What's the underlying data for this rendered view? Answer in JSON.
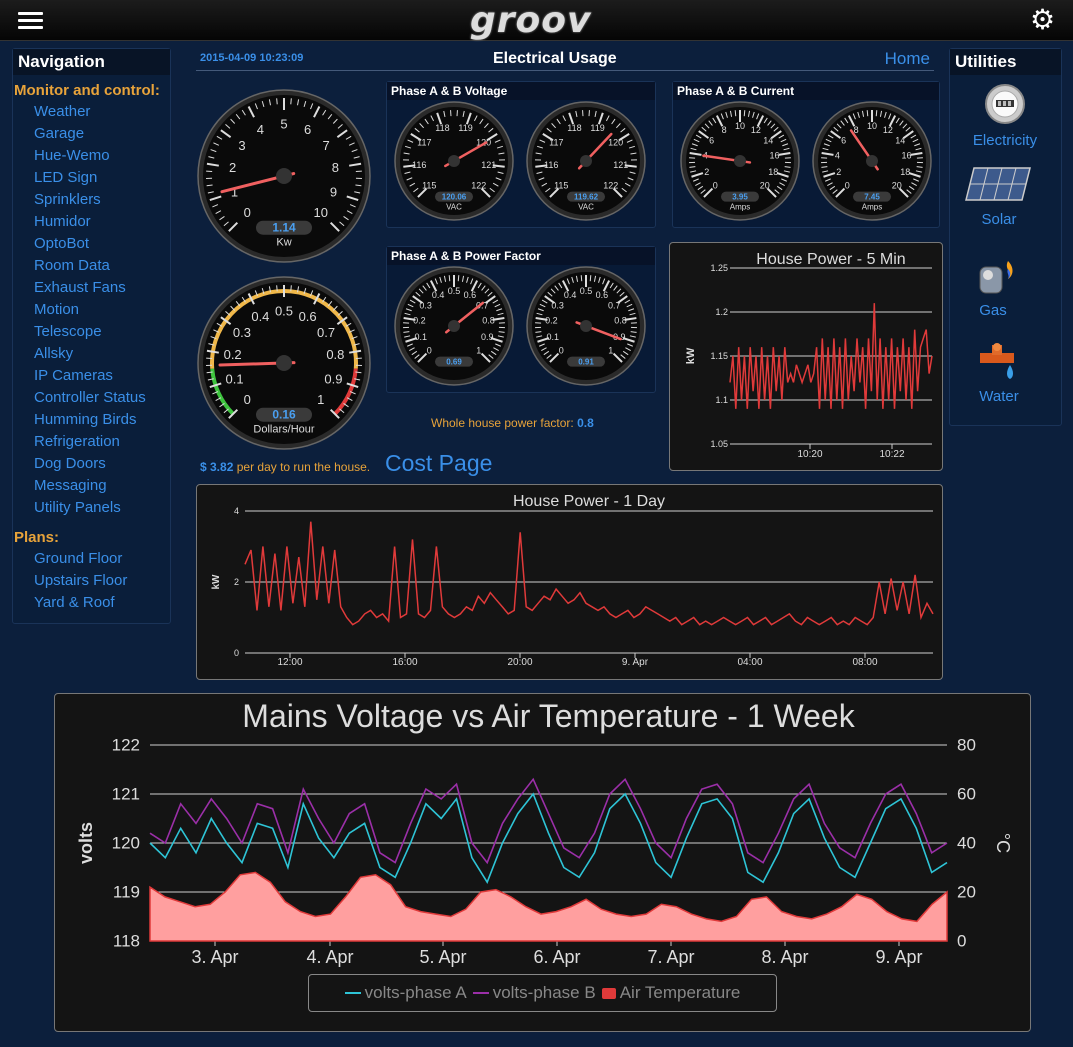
{
  "topbar": {
    "logo": "groov",
    "menu_icon": "hamburger-icon",
    "settings_icon": "gear-icon"
  },
  "navigation": {
    "title": "Navigation",
    "sections": [
      {
        "label": "Monitor and control:",
        "items": [
          "Weather",
          "Garage",
          "Hue-Wemo",
          "LED Sign",
          "Sprinklers",
          "Humidor",
          "OptoBot",
          "Room Data",
          "Exhaust Fans",
          "Motion",
          "Telescope",
          "Allsky",
          "IP Cameras",
          "Controller Status",
          "Humming Birds",
          "Refrigeration",
          "Dog Doors",
          "Messaging",
          "Utility Panels"
        ]
      },
      {
        "label": "Plans:",
        "items": [
          "Ground Floor",
          "Upstairs Floor",
          "Yard & Roof"
        ]
      }
    ]
  },
  "header": {
    "timestamp": "2015-04-09 10:23:09",
    "title": "Electrical Usage",
    "home": "Home"
  },
  "gauges": {
    "kw": {
      "value": 1.14,
      "display": "1.14",
      "unit": "Kw",
      "min": 0,
      "max": 10,
      "ticks": [
        "0",
        "1",
        "2",
        "3",
        "4",
        "5",
        "6",
        "7",
        "8",
        "9",
        "10"
      ]
    },
    "dollars": {
      "value": 0.16,
      "display": "0.16",
      "unit": "Dollars/Hour",
      "min": 0,
      "max": 1,
      "ticks": [
        "0",
        "0.1",
        "0.2",
        "0.3",
        "0.4",
        "0.5",
        "0.6",
        "0.7",
        "0.8",
        "0.9",
        "1"
      ]
    },
    "voltage": {
      "title": "Phase A & B Voltage",
      "ticks": [
        "115",
        "116",
        "117",
        "118",
        "119",
        "120",
        "121",
        "122"
      ],
      "min": 115,
      "max": 122,
      "unit": "VAC",
      "a": {
        "value": 120.06,
        "display": "120.06"
      },
      "b": {
        "value": 119.62,
        "display": "119.62"
      }
    },
    "current": {
      "title": "Phase A & B Current",
      "ticks": [
        "0",
        "2",
        "4",
        "6",
        "8",
        "10",
        "12",
        "14",
        "16",
        "18",
        "20"
      ],
      "min": 0,
      "max": 20,
      "unit": "Amps",
      "a": {
        "value": 3.95,
        "display": "3.95"
      },
      "b": {
        "value": 7.45,
        "display": "7.45"
      }
    },
    "power_factor": {
      "title": "Phase A & B Power Factor",
      "ticks": [
        "0",
        "0.1",
        "0.2",
        "0.3",
        "0.4",
        "0.5",
        "0.6",
        "0.7",
        "0.8",
        "0.9",
        "1"
      ],
      "min": 0,
      "max": 1,
      "a": {
        "value": 0.69,
        "display": "0.69"
      },
      "b": {
        "value": 0.91,
        "display": "0.91"
      }
    }
  },
  "whole_pf": {
    "label": "Whole house power factor:",
    "value": "0.8"
  },
  "cost": {
    "amount": "$ 3.82",
    "text": "per day to run the house.",
    "link": "Cost Page"
  },
  "utilities": {
    "title": "Utilities",
    "items": [
      {
        "label": "Electricity",
        "icon": "electric-meter-icon"
      },
      {
        "label": "Solar",
        "icon": "solar-panel-icon"
      },
      {
        "label": "Gas",
        "icon": "gas-meter-icon"
      },
      {
        "label": "Water",
        "icon": "water-valve-icon"
      }
    ]
  },
  "chart_data": [
    {
      "type": "line",
      "title": "House Power - 5 Min",
      "ylabel": "kW",
      "ylim": [
        1.05,
        1.25
      ],
      "yticks": [
        "1.05",
        "1.1",
        "1.15",
        "1.2",
        "1.25"
      ],
      "xticks": [
        "10:20",
        "10:22"
      ],
      "color": "#e03a3a",
      "series": [
        {
          "values": [
            1.12,
            1.15,
            1.09,
            1.16,
            1.1,
            1.15,
            1.09,
            1.16,
            1.11,
            1.15,
            1.09,
            1.16,
            1.1,
            1.15,
            1.09,
            1.16,
            1.11,
            1.15,
            1.1,
            1.16,
            1.12,
            1.13,
            1.12,
            1.14,
            1.13,
            1.12,
            1.13,
            1.14,
            1.12,
            1.13,
            1.16,
            1.09,
            1.17,
            1.1,
            1.16,
            1.09,
            1.17,
            1.1,
            1.16,
            1.09,
            1.17,
            1.1,
            1.15,
            1.11,
            1.17,
            1.12,
            1.16,
            1.09,
            1.17,
            1.11,
            1.21,
            1.1,
            1.17,
            1.09,
            1.16,
            1.1,
            1.17,
            1.09,
            1.16,
            1.11,
            1.17,
            1.1,
            1.16,
            1.09,
            1.18,
            1.11,
            1.16,
            1.17,
            1.18,
            1.13,
            1.15
          ]
        }
      ]
    },
    {
      "type": "line",
      "title": "House Power - 1 Day",
      "ylabel": "kW",
      "ylim": [
        0,
        4
      ],
      "yticks": [
        "0",
        "2",
        "4"
      ],
      "xticks": [
        "12:00",
        "16:00",
        "20:00",
        "9. Apr",
        "04:00",
        "08:00"
      ],
      "color": "#e03a3a",
      "series": [
        {
          "values": [
            2.5,
            2.9,
            1.2,
            3.0,
            1.3,
            2.8,
            1.2,
            3.0,
            1.4,
            2.7,
            1.3,
            3.7,
            1.5,
            3.0,
            1.4,
            2.9,
            1.3,
            1.0,
            0.8,
            0.9,
            1.1,
            1.2,
            1.0,
            1.1,
            0.9,
            3.0,
            1.0,
            1.1,
            3.2,
            1.1,
            1.0,
            1.2,
            3.0,
            1.3,
            1.1,
            1.0,
            1.1,
            1.3,
            1.2,
            1.6,
            1.4,
            1.7,
            1.5,
            1.3,
            1.1,
            1.2,
            3.4,
            1.3,
            1.2,
            1.4,
            1.6,
            1.5,
            1.8,
            1.6,
            1.4,
            1.5,
            1.7,
            1.4,
            1.3,
            1.2,
            1.3,
            1.1,
            1.0,
            1.1,
            1.2,
            1.0,
            1.1,
            1.3,
            1.2,
            1.1,
            1.0,
            0.9,
            1.0,
            0.8,
            0.9,
            1.0,
            0.8,
            0.9,
            0.8,
            0.9,
            1.0,
            0.9,
            0.8,
            0.9,
            1.0,
            0.8,
            0.9,
            1.0,
            0.8,
            0.9,
            1.0,
            1.1,
            0.9,
            0.8,
            1.0,
            0.9,
            0.8,
            0.9,
            1.0,
            0.8,
            0.9,
            0.8,
            1.0,
            0.9,
            0.8,
            1.0,
            2.0,
            1.1,
            2.1,
            1.2,
            2.0,
            1.1,
            2.2,
            1.0,
            1.4,
            1.1
          ]
        }
      ]
    },
    {
      "type": "line",
      "title": "Mains Voltage vs Air Temperature - 1 Week",
      "ylabel": "volts",
      "y2label": "°C",
      "ylim": [
        118,
        122
      ],
      "y2lim": [
        0,
        80
      ],
      "yticks": [
        "118",
        "119",
        "120",
        "121",
        "122"
      ],
      "y2ticks": [
        "0",
        "20",
        "40",
        "60",
        "80"
      ],
      "xticks": [
        "3. Apr",
        "4. Apr",
        "5. Apr",
        "6. Apr",
        "7. Apr",
        "8. Apr",
        "9. Apr"
      ],
      "legend_position": "bottom",
      "series": [
        {
          "name": "volts-phase A",
          "color": "#2ec4d6",
          "values": [
            120.0,
            119.7,
            120.3,
            119.8,
            120.5,
            120.0,
            119.6,
            120.4,
            120.3,
            119.5,
            120.8,
            120.1,
            119.7,
            120.2,
            120.4,
            119.5,
            119.3,
            120.0,
            120.8,
            120.5,
            120.9,
            119.7,
            119.2,
            120.0,
            120.6,
            121.0,
            120.2,
            119.5,
            119.3,
            119.8,
            120.7,
            121.0,
            120.4,
            119.6,
            119.3,
            120.1,
            120.8,
            120.9,
            120.5,
            119.4,
            119.2,
            119.8,
            120.6,
            120.9,
            120.1,
            119.5,
            119.3,
            120.0,
            120.7,
            120.9,
            120.3,
            119.4,
            119.6
          ]
        },
        {
          "name": "volts-phase B",
          "color": "#9b2fa8",
          "values": [
            120.2,
            120.0,
            120.8,
            120.4,
            120.9,
            120.5,
            120.0,
            120.8,
            120.7,
            119.8,
            121.1,
            120.5,
            120.0,
            120.6,
            120.8,
            119.8,
            119.6,
            120.4,
            121.1,
            120.9,
            121.2,
            120.0,
            119.6,
            120.4,
            120.9,
            121.3,
            120.6,
            119.9,
            119.7,
            120.2,
            121.0,
            121.3,
            120.7,
            120.0,
            119.7,
            120.5,
            121.1,
            121.2,
            120.8,
            119.8,
            119.6,
            120.2,
            120.9,
            121.2,
            120.4,
            119.9,
            119.7,
            120.4,
            121.0,
            121.2,
            120.6,
            119.8,
            120.0
          ]
        },
        {
          "name": "Air Temperature",
          "color": "#ff9f9f",
          "area": true,
          "values": [
            22,
            18,
            16,
            14,
            15,
            20,
            27,
            28,
            24,
            16,
            12,
            10,
            11,
            18,
            26,
            27,
            23,
            14,
            12,
            11,
            10,
            13,
            20,
            21,
            18,
            14,
            11,
            12,
            14,
            17,
            13,
            11,
            10,
            11,
            15,
            14,
            11,
            9,
            8,
            10,
            17,
            18,
            12,
            10,
            9,
            11,
            14,
            19,
            17,
            12,
            9,
            8,
            15,
            20
          ]
        }
      ]
    }
  ]
}
